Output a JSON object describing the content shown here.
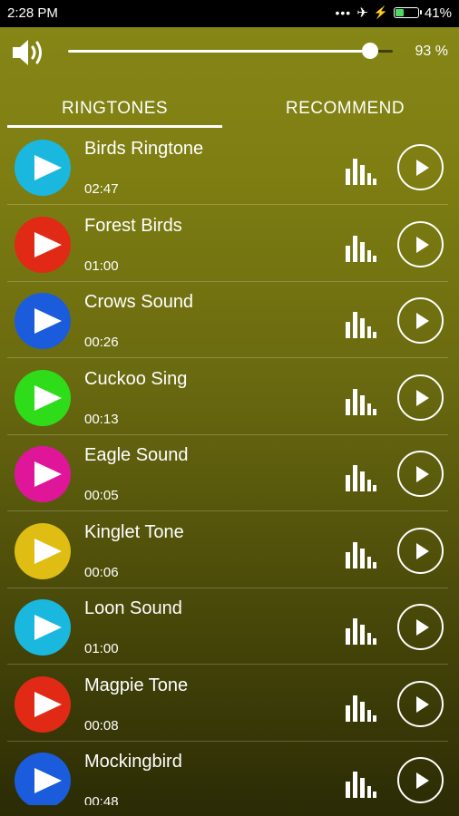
{
  "status_bar": {
    "time": "2:28 PM",
    "battery_text": "41%",
    "battery_level": 0.41
  },
  "volume": {
    "percent_text": "93 %",
    "level": 0.93
  },
  "tabs": [
    {
      "label": "RINGTONES",
      "active": true
    },
    {
      "label": "RECOMMEND",
      "active": false
    }
  ],
  "ringtones": [
    {
      "title": "Birds Ringtone",
      "duration": "02:47",
      "color": "#1ab8de"
    },
    {
      "title": "Forest Birds",
      "duration": "01:00",
      "color": "#e02a16"
    },
    {
      "title": "Crows Sound",
      "duration": "00:26",
      "color": "#1a5cdc"
    },
    {
      "title": "Cuckoo Sing",
      "duration": "00:13",
      "color": "#2fdc1a"
    },
    {
      "title": "Eagle Sound",
      "duration": "00:05",
      "color": "#e0169a"
    },
    {
      "title": "Kinglet Tone",
      "duration": "00:06",
      "color": "#dfbd12"
    },
    {
      "title": "Loon Sound",
      "duration": "01:00",
      "color": "#1ab8de"
    },
    {
      "title": "Magpie Tone",
      "duration": "00:08",
      "color": "#e02a16"
    },
    {
      "title": "Mockingbird",
      "duration": "00:48",
      "color": "#1a5cdc"
    }
  ],
  "icons": {
    "volume": "speaker-icon",
    "airplane": "airplane-icon",
    "charging": "bolt-icon",
    "battery": "battery-icon",
    "row_play": "play-icon",
    "equalizer": "equalizer-icon",
    "play_button": "play-circle-icon"
  }
}
